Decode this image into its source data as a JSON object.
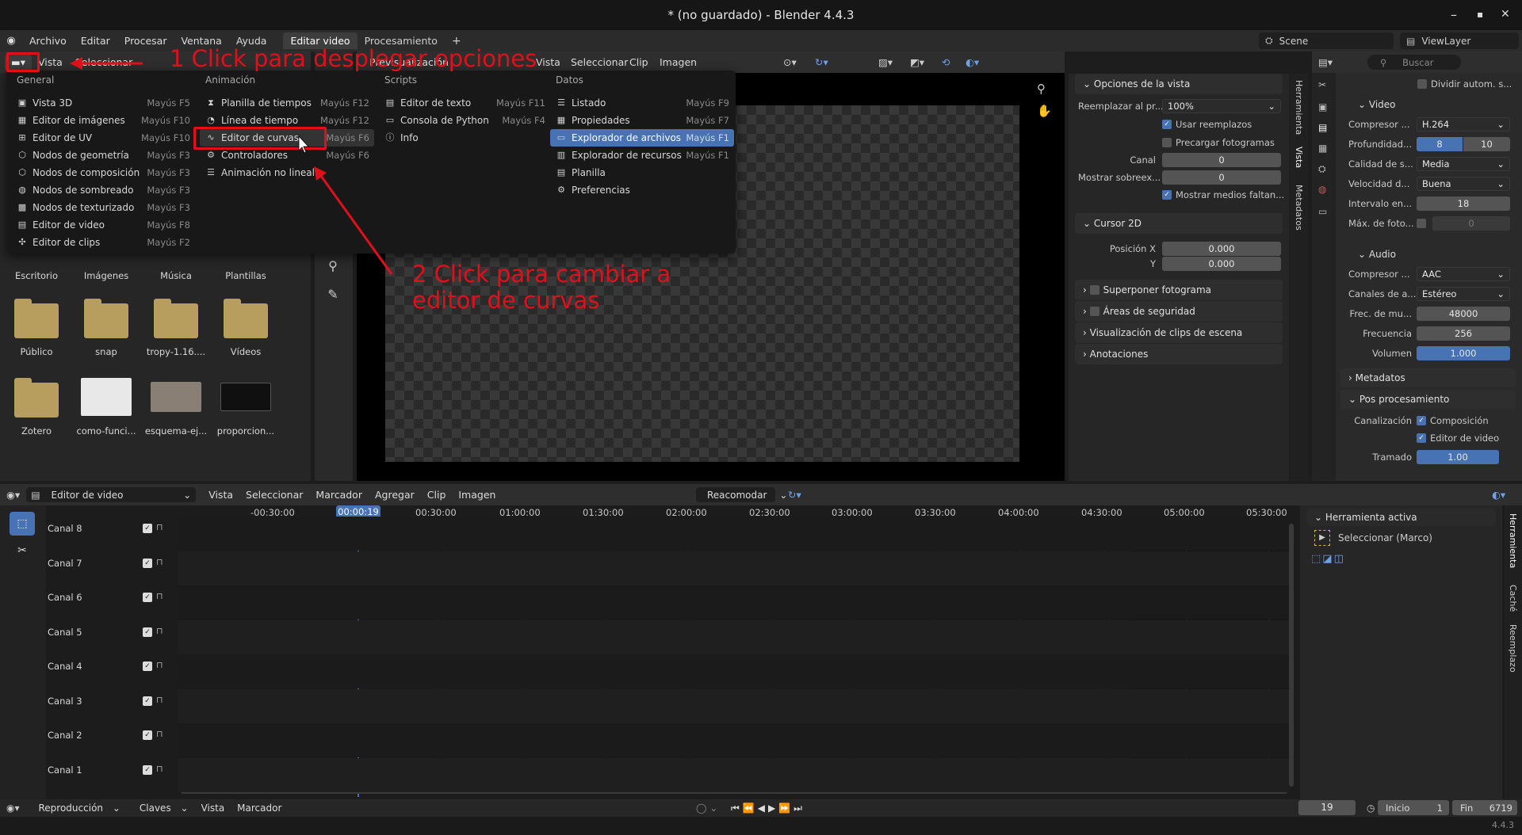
{
  "window": {
    "title": "* (no guardado) - Blender 4.4.3",
    "minimize": "–",
    "maximize": "▪",
    "close": "✕"
  },
  "topbar": {
    "menus": [
      "Archivo",
      "Editar",
      "Procesar",
      "Ventana",
      "Ayuda"
    ],
    "workspaces": [
      "Editar video",
      "Procesamiento"
    ],
    "add_workspace": "+",
    "scene": "Scene",
    "view_layer": "ViewLayer"
  },
  "file_browser": {
    "header": [
      "Vista",
      "Seleccionar"
    ],
    "items_row1": [
      "Escritorio",
      "Imágenes",
      "Música",
      "Plantillas"
    ],
    "items_row2": [
      "Público",
      "snap",
      "tropy-1.16....",
      "Vídeos"
    ],
    "items_row3": [
      "Zotero",
      "como-funci...",
      "esquema-ej...",
      "proporcion..."
    ]
  },
  "dropdown": {
    "columns": [
      {
        "title": "General",
        "items": [
          {
            "icon": "▣",
            "label": "Vista 3D",
            "shortcut": "Mayús F5"
          },
          {
            "icon": "▦",
            "label": "Editor de imágenes",
            "shortcut": "Mayús F10"
          },
          {
            "icon": "⊞",
            "label": "Editor de UV",
            "shortcut": "Mayús F10"
          },
          {
            "icon": "⬡",
            "label": "Nodos de geometría",
            "shortcut": "Mayús F3"
          },
          {
            "icon": "⬡",
            "label": "Nodos de composición",
            "shortcut": "Mayús F3"
          },
          {
            "icon": "◍",
            "label": "Nodos de sombreado",
            "shortcut": "Mayús F3"
          },
          {
            "icon": "▩",
            "label": "Nodos de texturizado",
            "shortcut": "Mayús F3"
          },
          {
            "icon": "▤",
            "label": "Editor de video",
            "shortcut": "Mayús F8"
          },
          {
            "icon": "✣",
            "label": "Editor de clips",
            "shortcut": "Mayús F2"
          }
        ]
      },
      {
        "title": "Animación",
        "items": [
          {
            "icon": "⧗",
            "label": "Planilla de tiempos",
            "shortcut": "Mayús F12"
          },
          {
            "icon": "◔",
            "label": "Línea de tiempo",
            "shortcut": "Mayús F12"
          },
          {
            "icon": "∿",
            "label": "Editor de curvas",
            "shortcut": "Mayús F6"
          },
          {
            "icon": "⚙",
            "label": "Controladores",
            "shortcut": "Mayús F6"
          },
          {
            "icon": "☰",
            "label": "Animación no lineal",
            "shortcut": ""
          }
        ]
      },
      {
        "title": "Scripts",
        "items": [
          {
            "icon": "▤",
            "label": "Editor de texto",
            "shortcut": "Mayús F11"
          },
          {
            "icon": "▭",
            "label": "Consola de Python",
            "shortcut": "Mayús F4"
          },
          {
            "icon": "ⓘ",
            "label": "Info",
            "shortcut": ""
          }
        ]
      },
      {
        "title": "Datos",
        "items": [
          {
            "icon": "☰",
            "label": "Listado",
            "shortcut": "Mayús F9"
          },
          {
            "icon": "▦",
            "label": "Propiedades",
            "shortcut": "Mayús F7"
          },
          {
            "icon": "▭",
            "label": "Explorador de archivos",
            "shortcut": "Mayús F1"
          },
          {
            "icon": "▥",
            "label": "Explorador de recursos",
            "shortcut": "Mayús F1"
          },
          {
            "icon": "▤",
            "label": "Planilla",
            "shortcut": ""
          },
          {
            "icon": "⚙",
            "label": "Preferencias",
            "shortcut": ""
          }
        ]
      }
    ]
  },
  "annotations": {
    "step1": "1 Click para desplegar opciones",
    "step2_line1": "2 Click para cambiar a",
    "step2_line2": "editor de curvas"
  },
  "preview_header": [
    "Vista",
    "Seleccionar",
    "Clip",
    "Imagen"
  ],
  "preview_header_partial": "Previsualización",
  "view_options": {
    "section": "Opciones de la vista",
    "replace_label": "Reemplazar al pr...",
    "replace_value": "100%",
    "use_proxies": "Usar reemplazos",
    "prefetch": "Precargar fotogramas",
    "channel_label": "Canal",
    "channel_value": "0",
    "overlay_label": "Mostrar sobreex...",
    "overlay_value": "0",
    "show_missing": "Mostrar medios faltan...",
    "cursor_section": "Cursor 2D",
    "pos_x_label": "Posición X",
    "pos_x_value": "0.000",
    "pos_y_label": "Y",
    "pos_y_value": "0.000",
    "collapsed": [
      "Superponer fotograma",
      "Áreas de seguridad",
      "Visualización de clips de escena",
      "Anotaciones"
    ],
    "tabs": [
      "Herramienta",
      "Vista",
      "Metadatos"
    ]
  },
  "properties": {
    "search_placeholder": "Buscar",
    "autosplit": "Dividir autom. s...",
    "video_section": "Video",
    "rows": [
      {
        "label": "Compresor ...",
        "value": "H.264"
      },
      {
        "label": "Profundidad...",
        "value_a": "8",
        "value_b": "10"
      },
      {
        "label": "Calidad de s...",
        "value": "Media"
      },
      {
        "label": "Velocidad d...",
        "value": "Buena"
      },
      {
        "label": "Intervalo en...",
        "value": "18"
      },
      {
        "label": "Máx. de foto...",
        "value": "0"
      }
    ],
    "audio_section": "Audio",
    "audio_rows": [
      {
        "label": "Compresor ...",
        "value": "AAC"
      },
      {
        "label": "Canales de a...",
        "value": "Estéreo"
      },
      {
        "label": "Frec. de mu...",
        "value": "48000"
      },
      {
        "label": "Frecuencia",
        "value": "256"
      },
      {
        "label": "Volumen",
        "value": "1.000"
      }
    ],
    "metadata_section": "Metadatos",
    "post_section": "Pos procesamiento",
    "pipeline_label": "Canalización",
    "composition": "Composición",
    "video_editor": "Editor de video",
    "dither_label": "Tramado",
    "dither_value": "1.00"
  },
  "sequencer": {
    "editor_type": "Editor de video",
    "header": [
      "Vista",
      "Seleccionar",
      "Marcador",
      "Agregar",
      "Clip",
      "Imagen"
    ],
    "snap": "Reacomodar",
    "current_frame_label": "00:00:19",
    "ticks": [
      "-00:30:00",
      "00:30:00",
      "01:00:00",
      "01:30:00",
      "02:00:00",
      "02:30:00",
      "03:00:00",
      "03:30:00",
      "04:00:00",
      "04:30:00",
      "05:00:00",
      "05:30:00"
    ],
    "channels": [
      "Canal 8",
      "Canal 7",
      "Canal 6",
      "Canal 5",
      "Canal 4",
      "Canal 3",
      "Canal 2",
      "Canal 1"
    ],
    "active_tool_section": "Herramienta activa",
    "active_tool": "Seleccionar (Marco)",
    "side_tabs": [
      "Herramienta",
      "Caché",
      "Reemplazo"
    ]
  },
  "status_bar": {
    "items": [
      "Reproducción",
      "Claves",
      "Vista",
      "Marcador"
    ],
    "frame": "19",
    "start_label": "Inicio",
    "start_value": "1",
    "end_label": "Fin",
    "end_value": "6719",
    "version": "4.4.3"
  }
}
